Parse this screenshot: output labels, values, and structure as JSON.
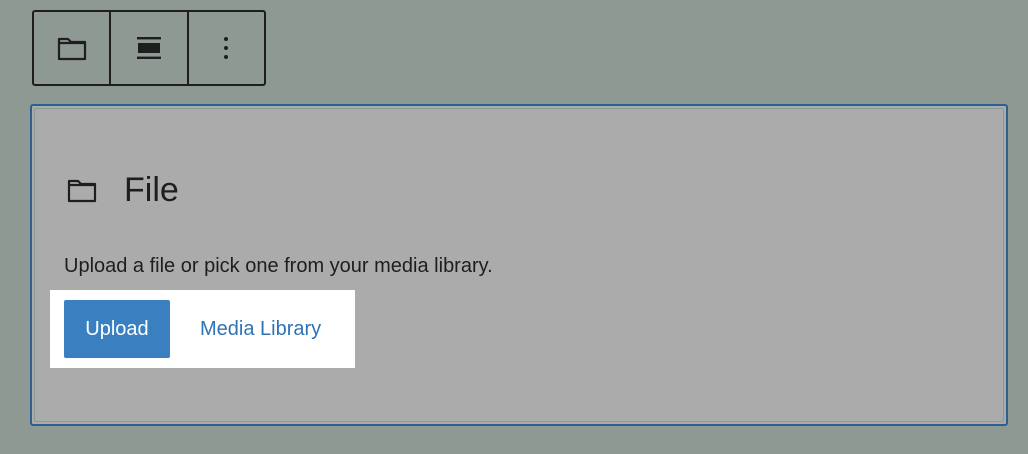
{
  "colors": {
    "page_background": "#8e9994",
    "placeholder_background": "#ababab",
    "placeholder_border": "#2d5f8f",
    "toolbar_border": "#1e1e1e",
    "primary_button": "#3a7fc0",
    "link": "#2f73b5",
    "text": "#1e1e1e",
    "highlight": "#ffffff"
  },
  "toolbar": {
    "items": [
      {
        "name": "file-block",
        "icon": "folder-icon"
      },
      {
        "name": "align",
        "icon": "align-wide-icon"
      },
      {
        "name": "options",
        "icon": "more-vertical-icon"
      }
    ]
  },
  "placeholder": {
    "icon": "folder-icon",
    "title": "File",
    "instructions": "Upload a file or pick one from your media library.",
    "upload_label": "Upload",
    "media_library_label": "Media Library"
  }
}
